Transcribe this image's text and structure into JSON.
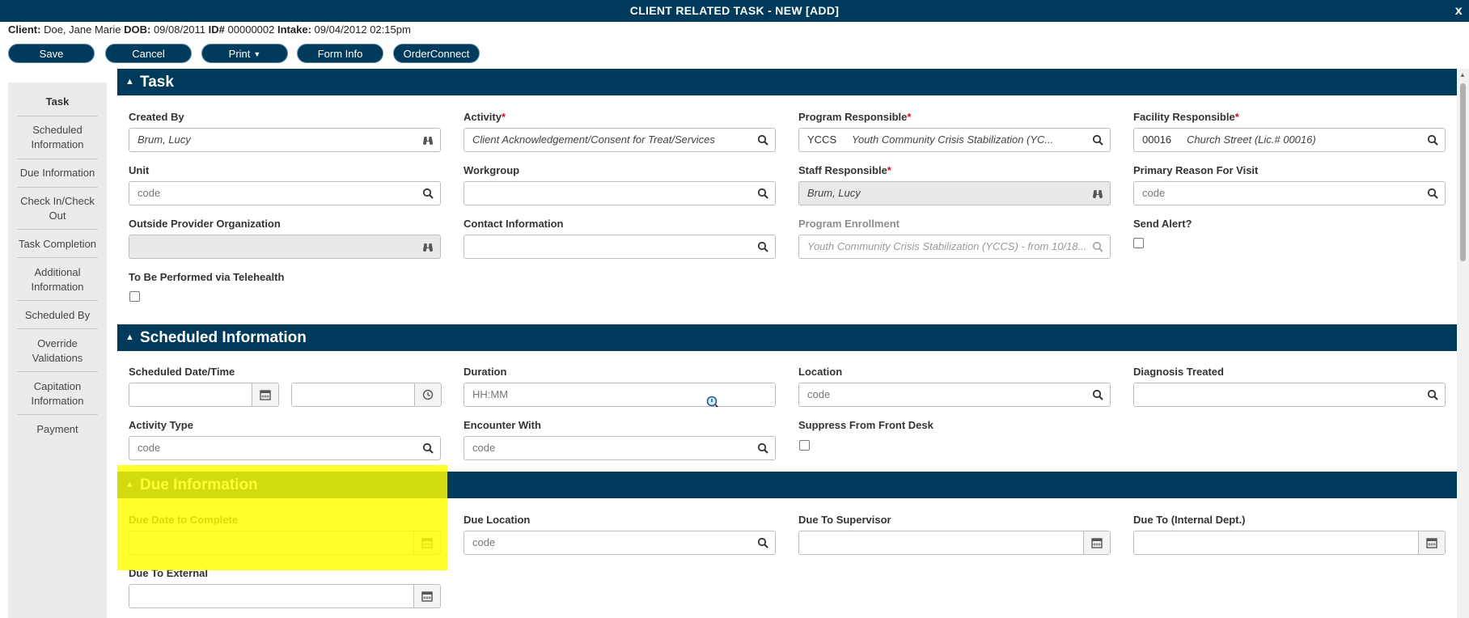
{
  "window": {
    "title": "CLIENT RELATED TASK - NEW [ADD]",
    "close_glyph": "x"
  },
  "client": {
    "client_label": "Client:",
    "client_value": "Doe, Jane Marie",
    "dob_label": "DOB:",
    "dob_value": "09/08/2011",
    "id_label": "ID#",
    "id_value": "00000002",
    "intake_label": "Intake:",
    "intake_value": "09/04/2012 02:15pm"
  },
  "toolbar": {
    "save": "Save",
    "cancel": "Cancel",
    "print": "Print",
    "form_info": "Form Info",
    "order_connect": "OrderConnect"
  },
  "sidenav": {
    "items": [
      "Task",
      "Scheduled Information",
      "Due Information",
      "Check In/Check Out",
      "Task Completion",
      "Additional Information",
      "Scheduled By",
      "Override Validations",
      "Capitation Information",
      "Payment"
    ]
  },
  "sections": {
    "task": {
      "title": "Task",
      "created_by": {
        "label": "Created By",
        "value": "Brum, Lucy"
      },
      "activity": {
        "label": "Activity",
        "value": "Client Acknowledgement/Consent for Treat/Services"
      },
      "program_responsible": {
        "label": "Program Responsible",
        "code": "YCCS",
        "value": "Youth Community Crisis Stabilization (YC..."
      },
      "facility_responsible": {
        "label": "Facility Responsible",
        "code": "00016",
        "value": "Church Street (Lic.# 00016)"
      },
      "unit": {
        "label": "Unit",
        "placeholder": "code"
      },
      "workgroup": {
        "label": "Workgroup"
      },
      "staff_responsible": {
        "label": "Staff Responsible",
        "value": "Brum, Lucy"
      },
      "primary_reason": {
        "label": "Primary Reason For Visit",
        "placeholder": "code"
      },
      "outside_provider": {
        "label": "Outside Provider Organization"
      },
      "contact_information": {
        "label": "Contact Information"
      },
      "program_enrollment": {
        "label": "Program Enrollment",
        "value": "Youth Community Crisis Stabilization (YCCS) - from 10/18..."
      },
      "send_alert": {
        "label": "Send Alert?",
        "checked": false
      },
      "telehealth": {
        "label": "To Be Performed via Telehealth",
        "checked": false
      }
    },
    "scheduled": {
      "title": "Scheduled Information",
      "date_time": {
        "label": "Scheduled Date/Time"
      },
      "duration": {
        "label": "Duration",
        "placeholder": "HH:MM"
      },
      "location": {
        "label": "Location",
        "placeholder": "code"
      },
      "diagnosis": {
        "label": "Diagnosis Treated"
      },
      "activity_type": {
        "label": "Activity Type",
        "placeholder": "code"
      },
      "encounter_with": {
        "label": "Encounter With",
        "placeholder": "code"
      },
      "suppress": {
        "label": "Suppress From Front Desk",
        "checked": false
      }
    },
    "due": {
      "title": "Due Information",
      "due_date": {
        "label": "Due Date to Complete"
      },
      "due_location": {
        "label": "Due Location",
        "placeholder": "code"
      },
      "due_supervisor": {
        "label": "Due To Supervisor"
      },
      "due_internal": {
        "label": "Due To (Internal Dept.)"
      },
      "due_external": {
        "label": "Due To External"
      }
    }
  },
  "required_marker": "*",
  "section_toggle_glyph": "▲",
  "colors": {
    "header": "#003b5c",
    "highlight": "#ffff00",
    "required": "#c8102e"
  }
}
